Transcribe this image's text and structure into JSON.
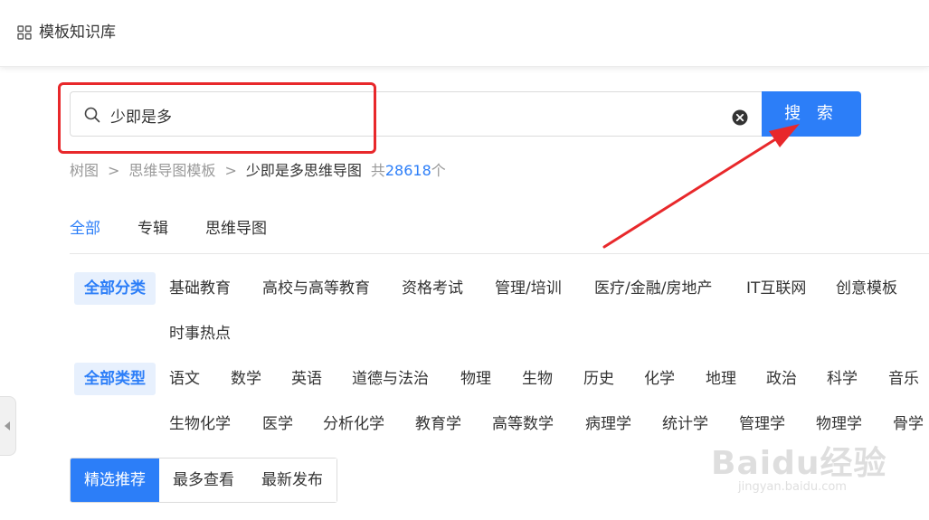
{
  "header": {
    "title": "模板知识库",
    "icon": "grid-icon"
  },
  "search": {
    "value": "少即是多",
    "button_label": "搜 索",
    "search_icon": "search-icon",
    "clear_icon": "clear-icon"
  },
  "breadcrumb": {
    "items": [
      "树图",
      "思维导图模板",
      "少即是多思维导图"
    ],
    "separator": ">",
    "count_prefix": "共",
    "count": "28618",
    "count_suffix": "个"
  },
  "tabs": [
    {
      "label": "全部",
      "active": true
    },
    {
      "label": "专辑",
      "active": false
    },
    {
      "label": "思维导图",
      "active": false
    }
  ],
  "category_filter": {
    "head": "全部分类",
    "items": [
      "基础教育",
      "高校与高等教育",
      "资格考试",
      "管理/培训",
      "医疗/金融/房地产",
      "IT互联网",
      "创意模板",
      "时事热点"
    ]
  },
  "type_filter": {
    "head": "全部类型",
    "items": [
      "语文",
      "数学",
      "英语",
      "道德与法治",
      "物理",
      "生物",
      "历史",
      "化学",
      "地理",
      "政治",
      "科学",
      "音乐",
      "生物化学",
      "医学",
      "分析化学",
      "教育学",
      "高等数学",
      "病理学",
      "统计学",
      "管理学",
      "物理学",
      "骨学"
    ]
  },
  "sort": [
    {
      "label": "精选推荐",
      "active": true
    },
    {
      "label": "最多查看",
      "active": false
    },
    {
      "label": "最新发布",
      "active": false
    }
  ],
  "watermark": {
    "text": "Baidu经验",
    "url": "jingyan.baidu.com"
  },
  "colors": {
    "accent": "#2c7ef8",
    "annotation_red": "#e8282b",
    "active_chip_bg": "#e7f0fd"
  }
}
